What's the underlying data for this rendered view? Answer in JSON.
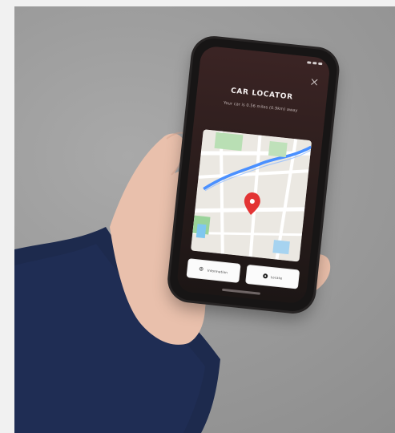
{
  "screen": {
    "title": "CAR LOCATOR",
    "subtitle": "Your car is 0.56 miles (0.9km) away",
    "buttons": [
      {
        "label": "Information",
        "icon": "info-icon"
      },
      {
        "label": "Locate",
        "icon": "target-icon"
      }
    ]
  },
  "colors": {
    "background_gray": "#9b9b9b",
    "sleeve_navy": "#1d2a4d",
    "phone_body": "#171515",
    "screen_top": "#3b2424",
    "map_pin": "#e33434",
    "route_blue": "#4a90ff"
  },
  "map": {
    "marker": "map-pin-icon"
  }
}
